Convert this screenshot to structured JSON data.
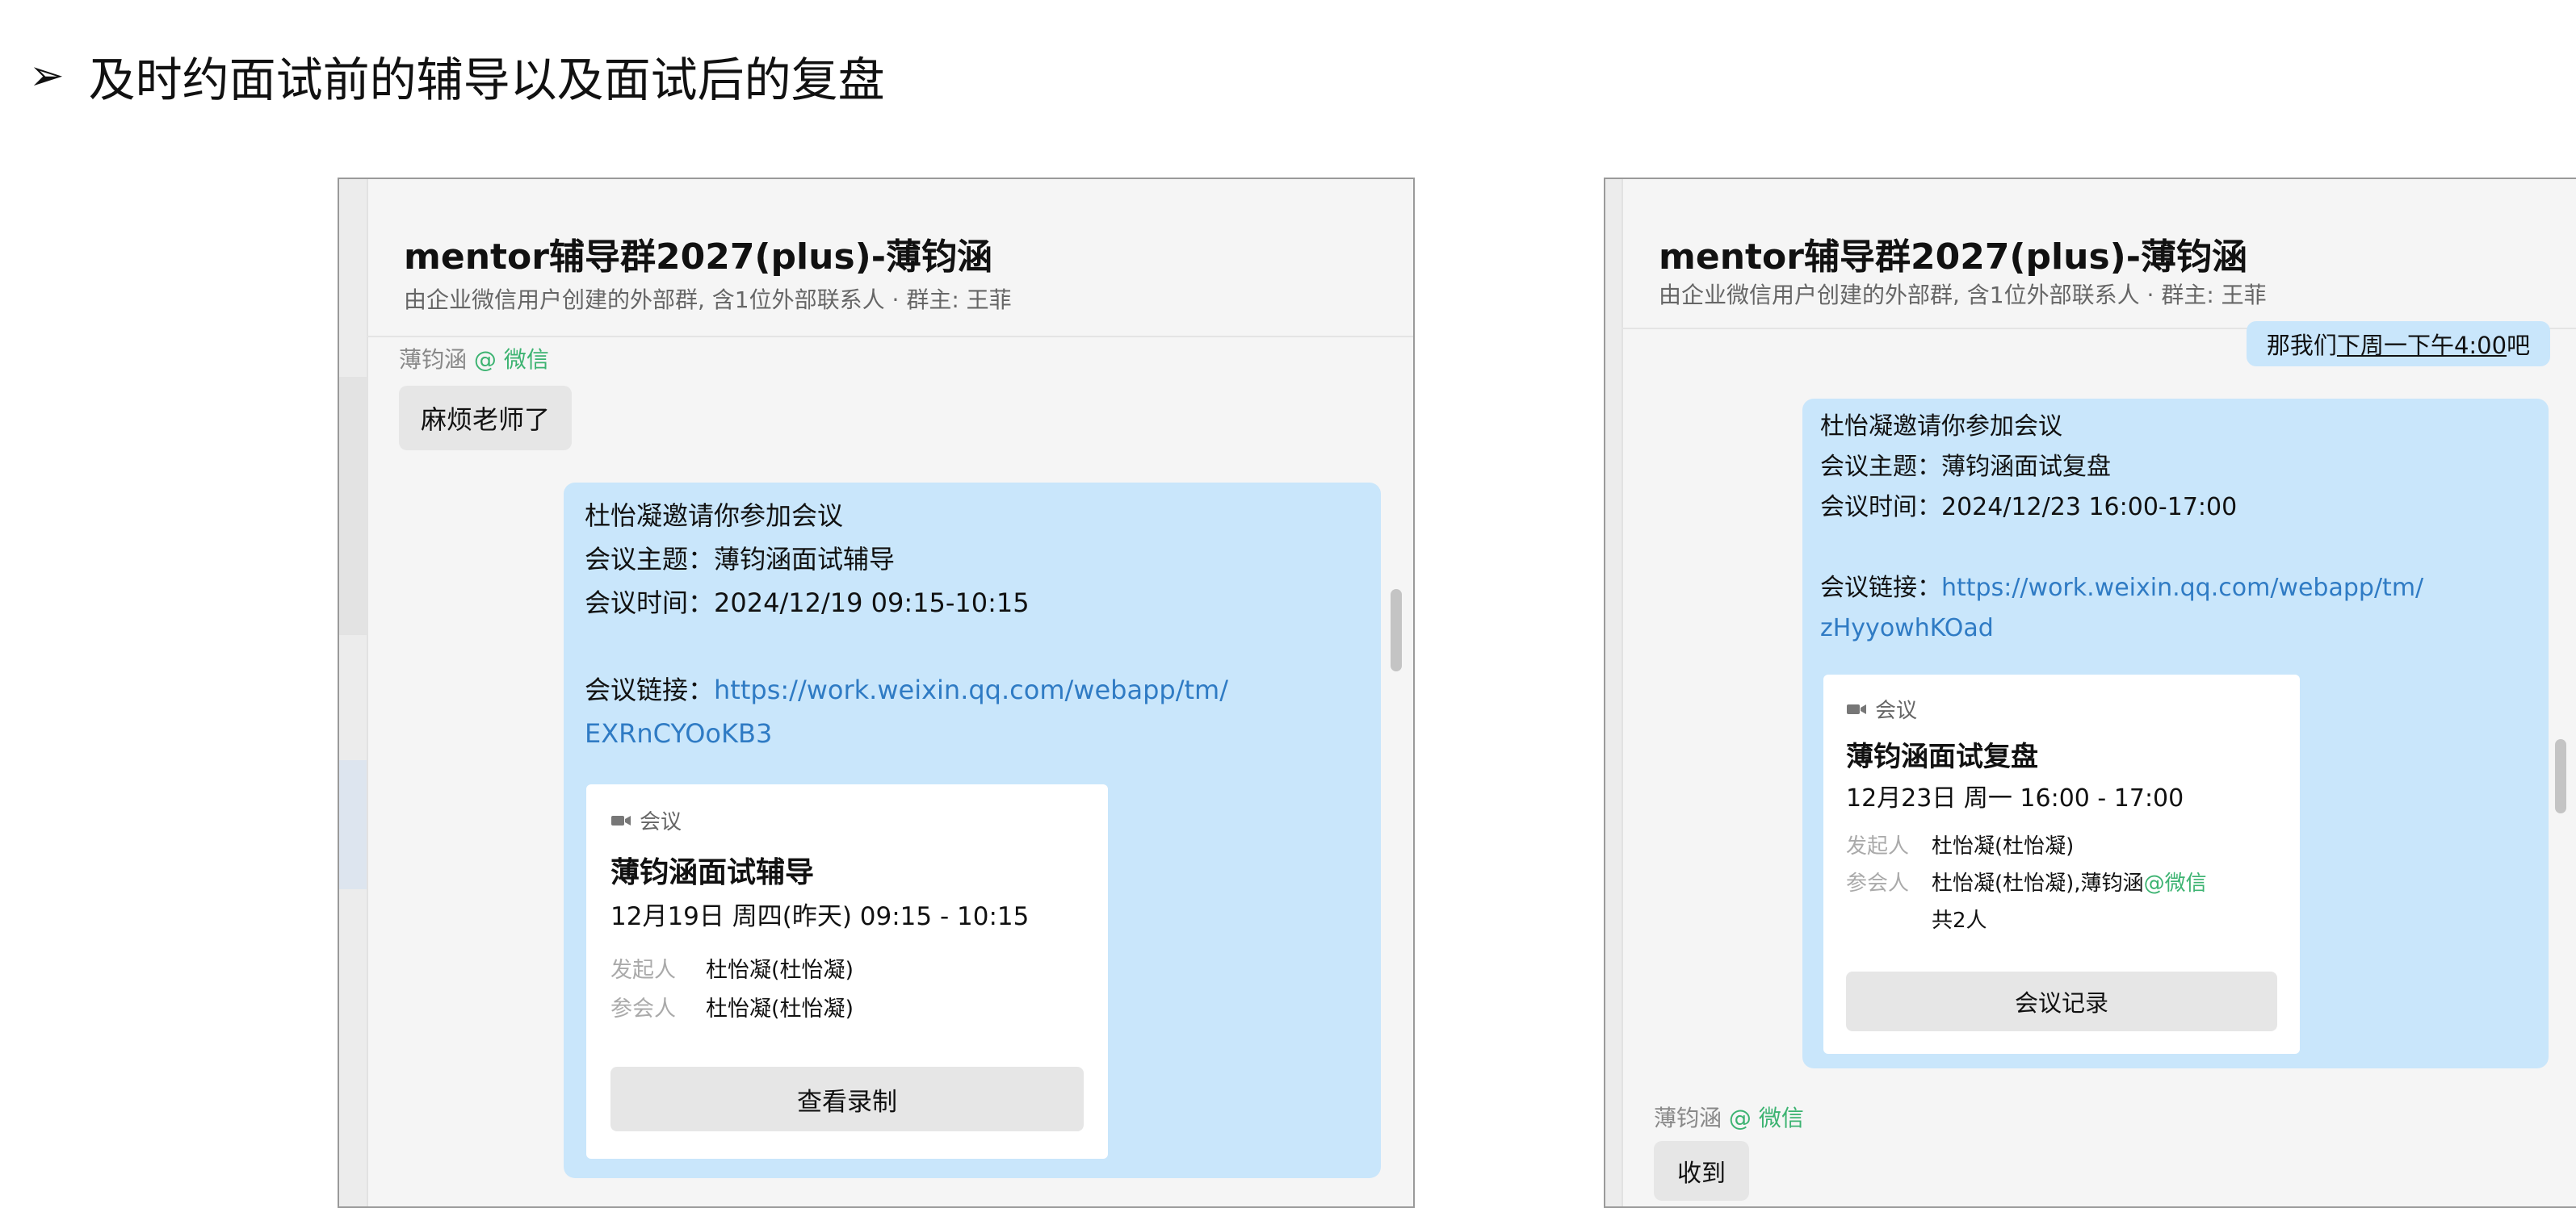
{
  "heading": {
    "bullet": "➢",
    "text": "及时约面试前的辅导以及面试后的复盘"
  },
  "chat_left": {
    "title": "mentor辅导群2027(plus)-薄钧涵",
    "subtitle": "由企业微信用户创建的外部群, 含1位外部联系人 · 群主: 王菲",
    "sender_name": "薄钧涵",
    "sender_source": "@ 微信",
    "msg_text": "麻烦老师了",
    "invite": {
      "l1": "杜怡凝邀请你参加会议",
      "l2": "会议主题：薄钧涵面试辅导",
      "l3": "会议时间：2024/12/19 09:15-10:15",
      "link_label": "会议链接：",
      "link_part1": "https://work.weixin.qq.com/webapp/tm/",
      "link_part2": "EXRnCYOoKB3"
    },
    "card": {
      "tag": "会议",
      "title": "薄钧涵面试辅导",
      "time": "12月19日 周四(昨天) 09:15 - 10:15",
      "organizer_label": "发起人",
      "organizer": "杜怡凝(杜怡凝)",
      "attendee_label": "参会人",
      "attendee": "杜怡凝(杜怡凝)",
      "button": "查看录制"
    }
  },
  "chat_right": {
    "title": "mentor辅导群2027(plus)-薄钧涵",
    "subtitle": "由企业微信用户创建的外部群, 含1位外部联系人 · 群主: 王菲",
    "prev_msg_prefix": "那我们",
    "prev_msg_underlined": "下周一下午4:00",
    "prev_msg_suffix": "吧",
    "invite": {
      "l1": "杜怡凝邀请你参加会议",
      "l2": "会议主题：薄钧涵面试复盘",
      "l3": "会议时间：2024/12/23 16:00-17:00",
      "link_label": "会议链接：",
      "link_part1": "https://work.weixin.qq.com/webapp/tm/",
      "link_part2": "zHyyowhKOad"
    },
    "card": {
      "tag": "会议",
      "title": "薄钧涵面试复盘",
      "time": "12月23日 周一 16:00 - 17:00",
      "organizer_label": "发起人",
      "organizer": "杜怡凝(杜怡凝)",
      "attendee_label": "参会人",
      "attendee": "杜怡凝(杜怡凝),薄钧涵",
      "attendee_source": "@微信",
      "count": "共2人",
      "button": "会议记录"
    },
    "sender_name": "薄钧涵",
    "sender_source": "@ 微信",
    "msg_text": "收到"
  },
  "colors": {
    "bubble_blue": "#c9e6fb",
    "link": "#2f7bc4",
    "wechat_green": "#3cb371"
  }
}
